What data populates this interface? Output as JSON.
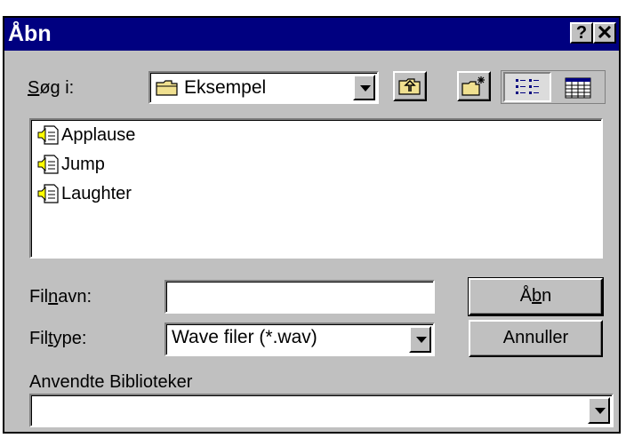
{
  "window": {
    "title": "Åbn",
    "help_button": "?",
    "close_button": "✕"
  },
  "lookin": {
    "label_prefix": "",
    "label_hotkey": "S",
    "label_rest": "øg i:",
    "value": "Eksempel"
  },
  "toolbar": {
    "up_folder": "up-folder-icon",
    "new_folder": "new-folder-icon",
    "list_view": "list-view-icon",
    "details_view": "details-view-icon"
  },
  "files": [
    {
      "name": "Applause",
      "icon": "wave-file-icon"
    },
    {
      "name": "Jump",
      "icon": "wave-file-icon"
    },
    {
      "name": "Laughter",
      "icon": "wave-file-icon"
    }
  ],
  "filename": {
    "label_prefix": "Fil",
    "label_hotkey": "n",
    "label_rest": "avn:",
    "value": ""
  },
  "filetype": {
    "label_prefix": "Fil",
    "label_hotkey": "t",
    "label_rest": "ype:",
    "value": "Wave filer (*.wav)"
  },
  "buttons": {
    "open_prefix": "Å",
    "open_hotkey": "b",
    "open_rest": "n",
    "cancel": "Annuller"
  },
  "libraries": {
    "label": "Anvendte Biblioteker",
    "value": ""
  }
}
